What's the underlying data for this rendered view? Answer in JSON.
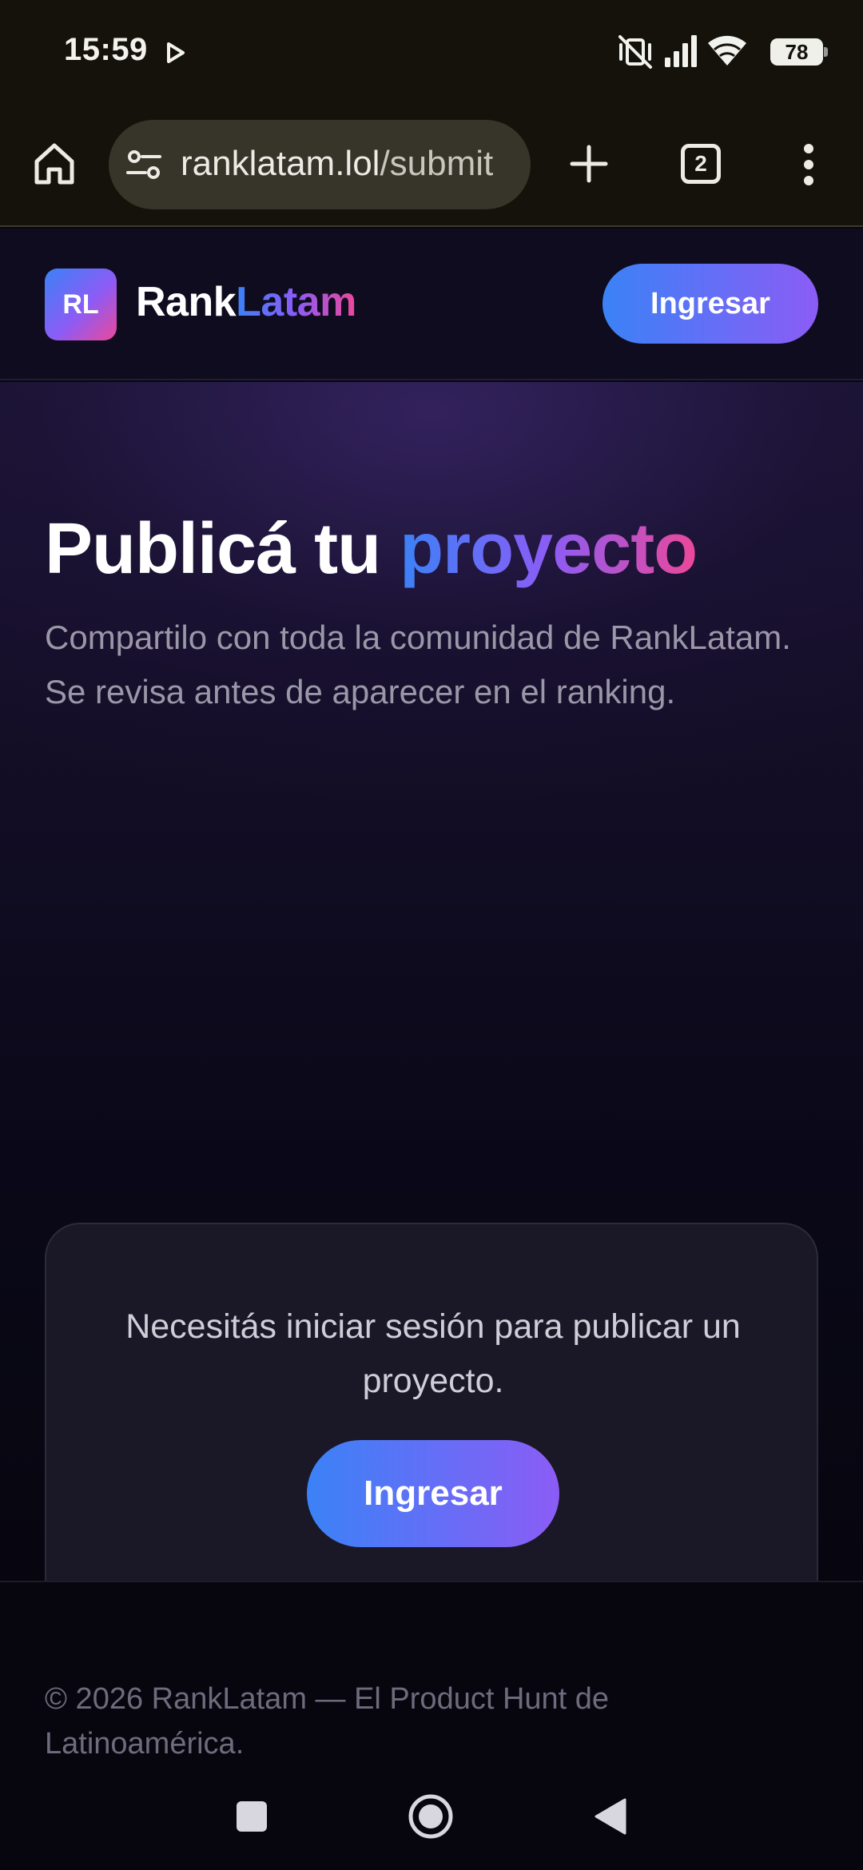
{
  "status_bar": {
    "time": "15:59",
    "battery": "78",
    "icons": [
      "play-icon",
      "vibrate-off-icon",
      "signal-icon",
      "wifi-icon",
      "battery-icon"
    ]
  },
  "browser": {
    "url_host": "ranklatam.lol",
    "url_path": "/submit",
    "tab_count": "2",
    "icons": [
      "home-icon",
      "site-settings-icon",
      "plus-icon",
      "tabs-icon",
      "more-vert-icon"
    ]
  },
  "header": {
    "logo_initials": "RL",
    "brand_part1": "Rank",
    "brand_part2": "Latam",
    "login_label": "Ingresar"
  },
  "hero": {
    "title_part1": "Publicá tu ",
    "title_accent": "proyecto",
    "subtitle": "Compartilo con toda la comunidad de RankLatam. Se revisa antes de aparecer en el ranking."
  },
  "card": {
    "message": "Necesitás iniciar sesión para publicar un proyecto.",
    "login_label": "Ingresar"
  },
  "footer": {
    "text": "© 2026 RankLatam — El Product Hunt de Latinoamérica."
  },
  "colors": {
    "accent_blue": "#3b82f6",
    "accent_violet": "#8b5cf6",
    "accent_pink": "#ec4899",
    "background": "#07060f"
  }
}
